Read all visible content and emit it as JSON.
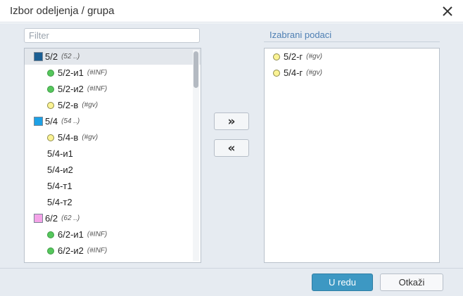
{
  "dialog": {
    "title": "Izbor odeljenja / grupa"
  },
  "filter": {
    "placeholder": "Filter",
    "value": ""
  },
  "left_list": {
    "items": [
      {
        "name": "5/2",
        "info": "(52 ..)",
        "swatch": "#1b5f93"
      },
      {
        "name": "5/2-и1",
        "info": "(#INF)",
        "dot": "green"
      },
      {
        "name": "5/2-и2",
        "info": "(#INF)",
        "dot": "green"
      },
      {
        "name": "5/2-в",
        "info": "(#gv)",
        "dot": "yellow"
      },
      {
        "name": "5/4",
        "info": "(54 ..)",
        "swatch": "#1da1e6"
      },
      {
        "name": "5/4-в",
        "info": "(#gv)",
        "dot": "yellow"
      },
      {
        "name": "5/4-и1"
      },
      {
        "name": "5/4-и2"
      },
      {
        "name": "5/4-т1"
      },
      {
        "name": "5/4-т2"
      },
      {
        "name": "6/2",
        "info": "(62 ..)",
        "swatch": "#f4a3e8"
      },
      {
        "name": "6/2-и1",
        "info": "(#INF)",
        "dot": "green"
      },
      {
        "name": "6/2-и2",
        "info": "(#INF)",
        "dot": "green"
      }
    ]
  },
  "right_list": {
    "title": "Izabrani podaci",
    "items": [
      {
        "name": "5/2-г",
        "info": "(#gv)",
        "dot": "yellow"
      },
      {
        "name": "5/4-г",
        "info": "(#gv)",
        "dot": "yellow"
      }
    ]
  },
  "move_buttons": {
    "add_label": "»",
    "remove_label": "«"
  },
  "footer": {
    "ok_label": "U redu",
    "cancel_label": "Otkaži"
  },
  "colors": {
    "accent": "#3d98c3",
    "panel_bg": "#e6ebf1",
    "green_dot": "#55c75c",
    "yellow_dot": "#fbf394"
  }
}
